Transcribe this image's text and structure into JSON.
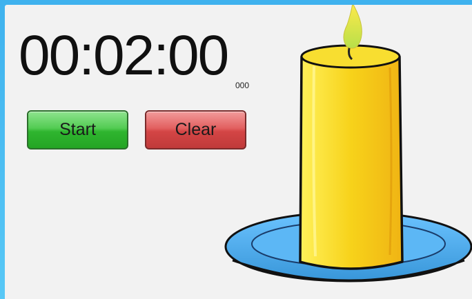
{
  "timer": {
    "display": "00:02:00",
    "milliseconds": "000"
  },
  "controls": {
    "start_label": "Start",
    "clear_label": "Clear"
  },
  "colors": {
    "background_frame": "#4ec0f4",
    "panel": "#f2f2f2",
    "start_green": "#3fbf3f",
    "clear_red": "#d44a4a",
    "candle_yellow": "#f7cf18",
    "saucer_blue": "#3b9fe0"
  },
  "illustration": {
    "icon": "candle-icon"
  }
}
